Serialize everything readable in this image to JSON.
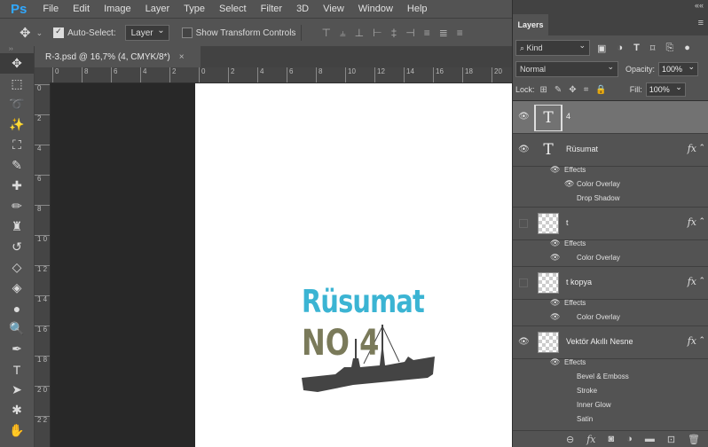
{
  "app": {
    "logo": "Ps"
  },
  "menu": [
    "File",
    "Edit",
    "Image",
    "Layer",
    "Type",
    "Select",
    "Filter",
    "3D",
    "View",
    "Window",
    "Help"
  ],
  "options": {
    "auto_select_label": "Auto-Select:",
    "auto_select_value": "Layer",
    "transform_label": "Show Transform Controls"
  },
  "document": {
    "tab_title": "R-3.psd @ 16,7% (4, CMYK/8*)",
    "close": "×",
    "art_title": "Rüsumat",
    "art_no": "NO 4"
  },
  "ruler": {
    "h_ticks": [
      "0",
      "8",
      "6",
      "4",
      "2",
      "0",
      "2",
      "4",
      "6",
      "8",
      "10",
      "12",
      "14",
      "16",
      "18",
      "20"
    ],
    "v_ticks": [
      "0",
      "2",
      "4",
      "6",
      "8",
      "1 0",
      "1 2",
      "1 4",
      "1 6",
      "1 8",
      "2 0",
      "2 2"
    ]
  },
  "layers_panel": {
    "tab": "Layers",
    "filter_kind": "Kind",
    "blend_mode": "Normal",
    "opacity_label": "Opacity:",
    "opacity_value": "100%",
    "lock_label": "Lock:",
    "fill_label": "Fill:",
    "fill_value": "100%",
    "layers": [
      {
        "name": "4",
        "type": "text",
        "selected": true,
        "visible": true
      },
      {
        "name": "Rüsumat",
        "type": "text",
        "visible": true,
        "fx": "fx",
        "effects_label": "Effects",
        "effects": [
          "Color Overlay",
          "Drop Shadow"
        ]
      },
      {
        "name": "t",
        "type": "raster",
        "visible": false,
        "fx": "fx",
        "effects_label": "Effects",
        "effects": [
          "Color Overlay"
        ]
      },
      {
        "name": "t kopya",
        "type": "raster",
        "visible": false,
        "fx": "fx",
        "effects_label": "Effects",
        "effects": [
          "Color Overlay"
        ]
      },
      {
        "name": "Vektör Akıllı Nesne",
        "type": "smart",
        "visible": true,
        "fx": "fx",
        "effects_label": "Effects",
        "effects": [
          "Bevel & Emboss",
          "Stroke",
          "Inner Glow",
          "Satin"
        ]
      }
    ],
    "bottom_icons": [
      "link-icon",
      "fx-icon",
      "mask-icon",
      "adjustment-icon",
      "folder-icon",
      "new-layer-icon",
      "trash-icon"
    ]
  },
  "colors": {
    "accent": "#31a8ff",
    "art_blue": "#3bb4d3",
    "art_olive": "#7a7a5a"
  }
}
